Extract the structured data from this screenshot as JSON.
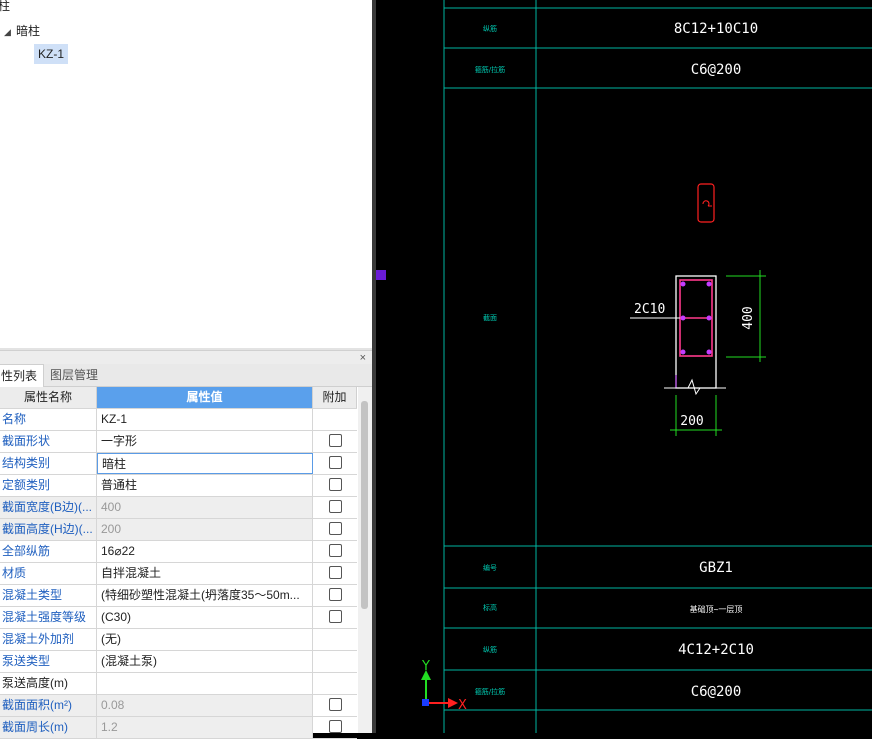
{
  "tree": {
    "root_label": "柱",
    "group_label": "暗柱",
    "selected_item": "KZ-1"
  },
  "panel": {
    "close_label": "×",
    "tabs": [
      "性列表",
      "图层管理"
    ]
  },
  "grid": {
    "headers": [
      "属性名称",
      "属性值",
      "附加"
    ],
    "rows": [
      {
        "name": "名称",
        "value": "KZ-1",
        "checkbox": false,
        "disabled": false,
        "plain": false
      },
      {
        "name": "截面形状",
        "value": "一字形",
        "checkbox": true,
        "disabled": false,
        "plain": false
      },
      {
        "name": "结构类别",
        "value": "暗柱",
        "checkbox": true,
        "disabled": false,
        "plain": false
      },
      {
        "name": "定额类别",
        "value": "普通柱",
        "checkbox": true,
        "disabled": false,
        "plain": false
      },
      {
        "name": "截面宽度(B边)(...",
        "value": "400",
        "checkbox": true,
        "disabled": true,
        "plain": false
      },
      {
        "name": "截面高度(H边)(...",
        "value": "200",
        "checkbox": true,
        "disabled": true,
        "plain": false
      },
      {
        "name": "全部纵筋",
        "value": "16⌀22",
        "checkbox": true,
        "disabled": false,
        "plain": false
      },
      {
        "name": "材质",
        "value": "自拌混凝土",
        "checkbox": true,
        "disabled": false,
        "plain": false
      },
      {
        "name": "混凝土类型",
        "value": "(特细砂塑性混凝土(坍落度35～50m...",
        "checkbox": true,
        "disabled": false,
        "plain": false
      },
      {
        "name": "混凝土强度等级",
        "value": "(C30)",
        "checkbox": true,
        "disabled": false,
        "plain": false
      },
      {
        "name": "混凝土外加剂",
        "value": "(无)",
        "checkbox": false,
        "disabled": false,
        "plain": false
      },
      {
        "name": "泵送类型",
        "value": "(混凝土泵)",
        "checkbox": false,
        "disabled": false,
        "plain": false
      },
      {
        "name": "泵送高度(m)",
        "value": "",
        "checkbox": false,
        "disabled": false,
        "plain": true
      },
      {
        "name": "截面面积(m²)",
        "value": "0.08",
        "checkbox": true,
        "disabled": true,
        "plain": false
      },
      {
        "name": "截面周长(m)",
        "value": "1.2",
        "checkbox": true,
        "disabled": true,
        "plain": false
      }
    ]
  },
  "cad": {
    "top_rows": [
      {
        "label": "纵筋",
        "value": "8C12+10C10"
      },
      {
        "label": "箍筋/拉筋",
        "value": "C6@200"
      }
    ],
    "section_label": "截面",
    "rebar_label": "2C10",
    "dim_height": "400",
    "dim_width": "200",
    "bottom_rows": [
      {
        "label": "编号",
        "value": "GBZ1"
      },
      {
        "label": "标高",
        "value": "基础顶~一层顶"
      },
      {
        "label": "纵筋",
        "value": "4C12+2C10"
      },
      {
        "label": "箍筋/拉筋",
        "value": "C6@200"
      }
    ],
    "axis_y": "Y",
    "axis_x": "X"
  }
}
